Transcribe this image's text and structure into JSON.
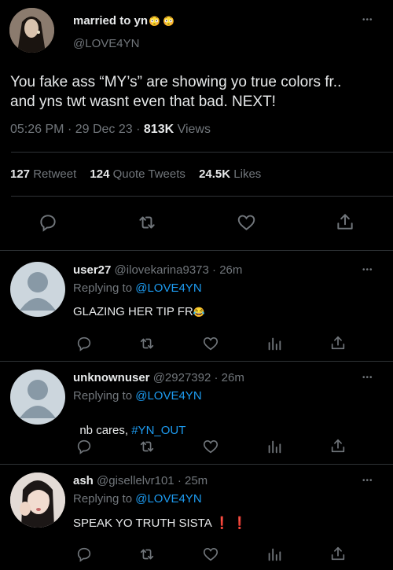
{
  "tweet": {
    "display_name": "married to yn",
    "name_emojis": "😳 😳",
    "handle": "@LOVE4YN",
    "text_line1": "You fake ass “MY’s” are showing yo true colors fr..",
    "text_line2": "and yns twt wasnt even that bad. NEXT!",
    "time": "05:26 PM",
    "date": "29 Dec 23",
    "sep": "·",
    "views_count": "813K",
    "views_label": "Views",
    "retweets_count": "127",
    "retweets_label": "Retweet",
    "quotes_count": "124",
    "quotes_label": "Quote Tweets",
    "likes_count": "24.5K",
    "likes_label": "Likes",
    "more": "•••"
  },
  "replies": [
    {
      "name": "user27",
      "handle": "@ilovekarina9373",
      "time": "26m",
      "replying_label": "Replying to",
      "replying_to": "@LOVE4YN",
      "text": "GLAZING HER TIP FR",
      "emoji": "😂"
    },
    {
      "name": "unknownuser",
      "handle": "@2927392",
      "time": "26m",
      "replying_label": "Replying to",
      "replying_to": "@LOVE4YN",
      "text": "nb cares, ",
      "hashtag": "#YN_OUT"
    },
    {
      "name": "ash",
      "handle": "@gisellelvr101",
      "time": "25m",
      "replying_label": "Replying to",
      "replying_to": "@LOVE4YN",
      "text": "SPEAK YO TRUTH SISTA",
      "emoji": "❗ ❗"
    }
  ],
  "sep": "·",
  "colors": {
    "background": "#000000",
    "text": "#e7e9ea",
    "muted": "#71767b",
    "link": "#1d9bf0",
    "divider": "#2f3336"
  }
}
